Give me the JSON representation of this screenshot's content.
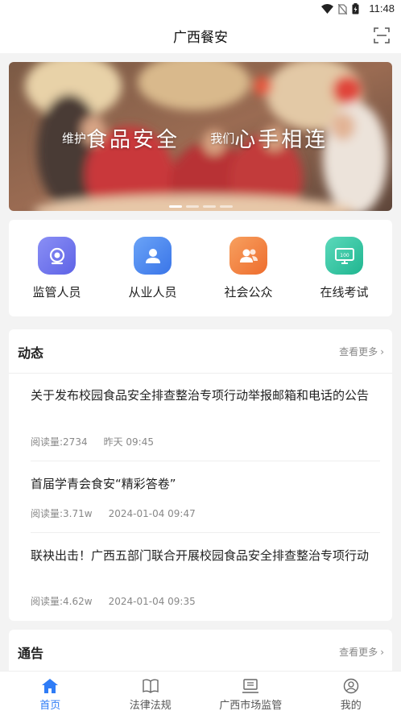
{
  "status": {
    "time": "11:48"
  },
  "app": {
    "title": "广西餐安"
  },
  "banner": {
    "slogan_small_1": "维护",
    "slogan_big_1": "食品安全",
    "slogan_small_2": "我们",
    "slogan_big_2": "心手相连",
    "slide_count": 4,
    "active_slide": 1
  },
  "quick_entries": [
    {
      "label": "监管人员",
      "icon": "camera-icon",
      "color": "#6e74ee"
    },
    {
      "label": "从业人员",
      "icon": "person-icon",
      "color": "#4a86f0"
    },
    {
      "label": "社会公众",
      "icon": "group-icon",
      "color": "#f27a3c"
    },
    {
      "label": "在线考试",
      "icon": "monitor-icon",
      "color": "#2fc5a4"
    }
  ],
  "news": {
    "title": "动态",
    "more": "查看更多",
    "read_label": "阅读量:",
    "items": [
      {
        "title": "关于发布校园食品安全排查整治专项行动举报邮箱和电话的公告",
        "reads": "2734",
        "time": "昨天 09:45"
      },
      {
        "title": "首届学青会食安“精彩答卷”",
        "reads": "3.71w",
        "time": "2024-01-04 09:47"
      },
      {
        "title": "联袂出击！广西五部门联合开展校园食品安全排查整治专项行动",
        "reads": "4.62w",
        "time": "2024-01-04 09:35"
      }
    ]
  },
  "notice": {
    "title": "通告",
    "more": "查看更多"
  },
  "tabs": [
    {
      "label": "首页",
      "icon": "home-icon"
    },
    {
      "label": "法律法规",
      "icon": "book-icon"
    },
    {
      "label": "广西市场监管",
      "icon": "screen-icon"
    },
    {
      "label": "我的",
      "icon": "profile-icon"
    }
  ],
  "active_tab": "首页",
  "accent": "#2f7cf6"
}
